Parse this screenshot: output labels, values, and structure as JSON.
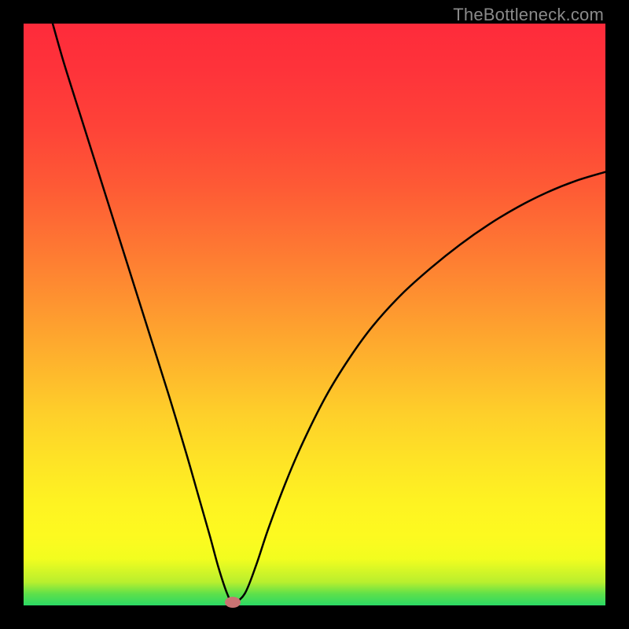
{
  "watermark": "TheBottleneck.com",
  "chart_data": {
    "type": "line",
    "title": "",
    "xlabel": "",
    "ylabel": "",
    "xlim": [
      0,
      100
    ],
    "ylim": [
      0,
      100
    ],
    "grid": false,
    "legend": false,
    "series": [
      {
        "name": "curve",
        "x": [
          5,
          7,
          10,
          13,
          16,
          19,
          22,
          25,
          28,
          30,
          32,
          33.5,
          35,
          36,
          38,
          40,
          42,
          45,
          48,
          52,
          56,
          60,
          65,
          70,
          75,
          80,
          85,
          90,
          95,
          100
        ],
        "y": [
          100,
          93,
          83.5,
          74,
          64.5,
          55,
          45.5,
          36,
          26,
          19,
          12,
          6.5,
          2,
          0.5,
          2,
          7,
          13,
          21,
          28,
          36,
          42.5,
          48,
          53.5,
          58,
          62,
          65.5,
          68.5,
          71,
          73,
          74.5
        ]
      }
    ],
    "marker": {
      "x": 36,
      "y": 0.5,
      "color": "#c97272"
    },
    "colors": {
      "curve": "#000000",
      "gradient_top": "#fe2b3b",
      "gradient_mid": "#fee326",
      "gradient_bottom": "#2bd965",
      "background_frame": "#000000"
    }
  }
}
